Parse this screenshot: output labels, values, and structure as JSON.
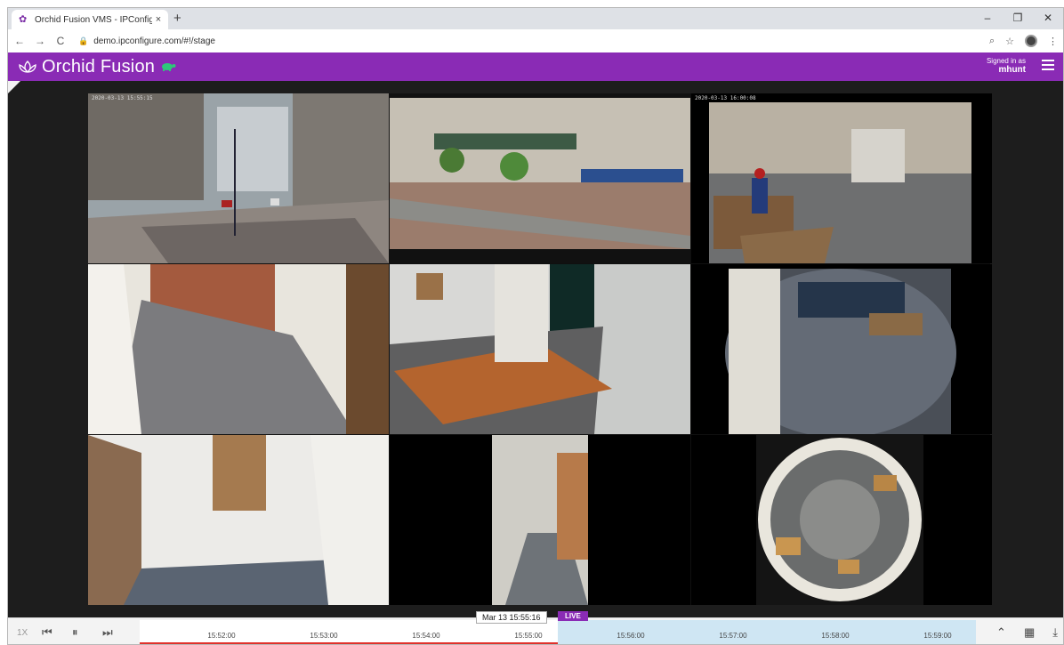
{
  "browser": {
    "tab_title": "Orchid Fusion VMS - IPConfigure",
    "tab_close": "×",
    "new_tab": "+",
    "url": "demo.ipconfigure.com/#!/stage",
    "nav": {
      "back": "←",
      "forward": "→",
      "reload": "C"
    },
    "window": {
      "minimize": "–",
      "restore": "❐",
      "close": "✕"
    }
  },
  "app": {
    "brand": "Orchid Fusion",
    "signed_in_label": "Signed in as",
    "username": "mhunt"
  },
  "cameras": [
    {
      "id": "cam1",
      "timestamp": "2020-03-13 15:55:15"
    },
    {
      "id": "cam2",
      "timestamp": ""
    },
    {
      "id": "cam3",
      "timestamp": "2020-03-13 16:00:08"
    },
    {
      "id": "cam4",
      "timestamp": ""
    },
    {
      "id": "cam5",
      "timestamp": ""
    },
    {
      "id": "cam6",
      "timestamp": ""
    },
    {
      "id": "cam7",
      "timestamp": ""
    },
    {
      "id": "cam8",
      "timestamp": ""
    },
    {
      "id": "cam9",
      "timestamp": ""
    }
  ],
  "timeline": {
    "speed": "1X",
    "current_time": "Mar 13 15:55:16",
    "live_label": "LIVE",
    "ticks": [
      "15:52:00",
      "15:53:00",
      "15:54:00",
      "15:55:00",
      "15:56:00",
      "15:57:00",
      "15:58:00",
      "15:59:00"
    ]
  },
  "colors": {
    "brand": "#8a2bb5",
    "live": "#8a2bb5",
    "recorded": "#e0302a",
    "future": "#cfe6f3"
  }
}
